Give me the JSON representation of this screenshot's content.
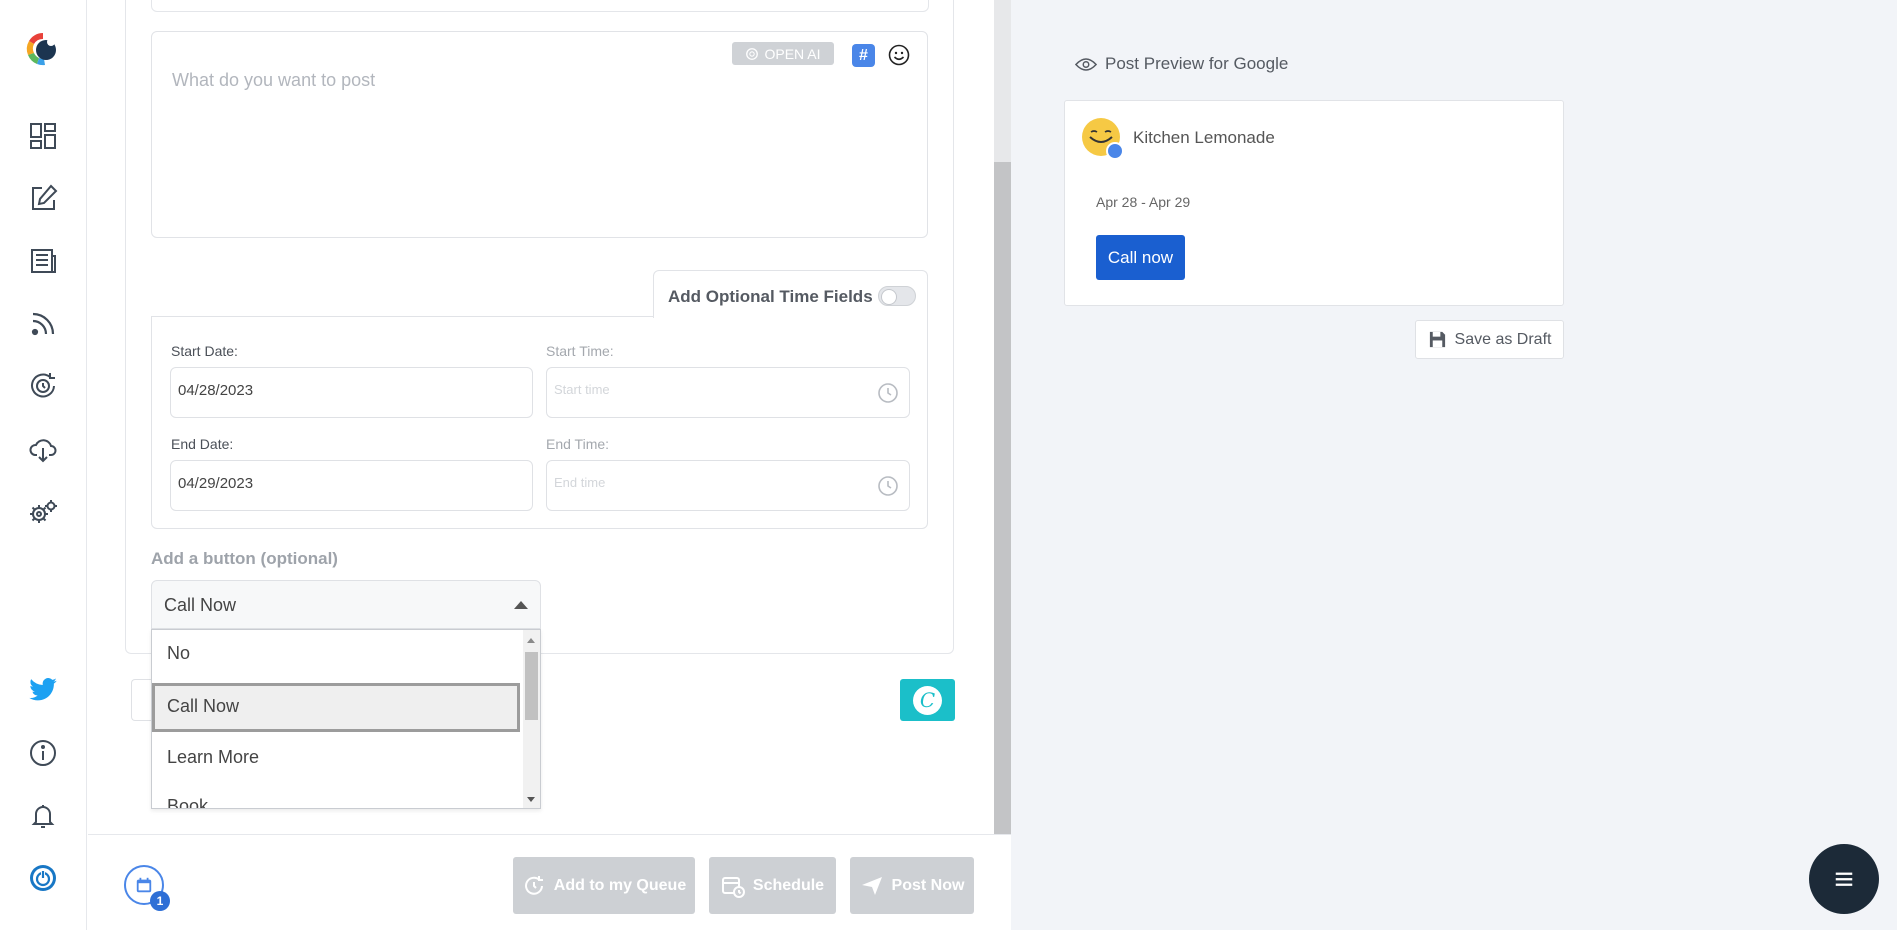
{
  "editor": {
    "placeholder": "What do you want to post",
    "openai_label": "OPEN AI",
    "hashtag_symbol": "#",
    "optional_time_label": "Add Optional Time Fields",
    "start_date_label": "Start Date:",
    "start_date_value": "04/28/2023",
    "start_time_label": "Start Time:",
    "start_time_placeholder": "Start time",
    "end_date_label": "End Date:",
    "end_date_value": "04/29/2023",
    "end_time_label": "End Time:",
    "end_time_placeholder": "End time",
    "button_section_label": "Add a button (optional)",
    "button_select_value": "Call Now",
    "button_options": [
      "No",
      "Call Now",
      "Learn More",
      "Book"
    ],
    "canva_letter": "C"
  },
  "bottom_bar": {
    "queue_count": "1",
    "add_queue_label": "Add to my Queue",
    "schedule_label": "Schedule",
    "post_now_label": "Post Now"
  },
  "preview": {
    "title": "Post Preview for Google",
    "business_name": "Kitchen Lemonade",
    "date_range": "Apr 28 - Apr 29",
    "cta_label": "Call now",
    "save_draft_label": "Save as Draft"
  },
  "colors": {
    "accent_blue": "#1a5fd0",
    "twitter_blue": "#1da1f2",
    "canva_teal": "#1bbfc9",
    "disabled_gray": "#cdd0d4",
    "fab_dark": "#1c2a38"
  }
}
